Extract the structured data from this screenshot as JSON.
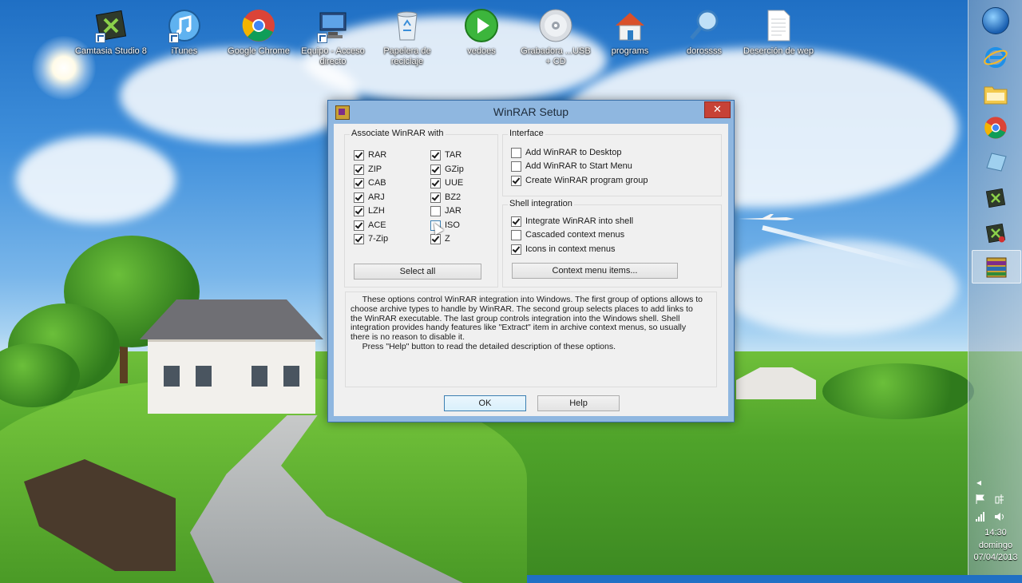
{
  "desktop_icons": [
    {
      "label": "Camtasia Studio 8",
      "icon": "camtasia-icon"
    },
    {
      "label": "iTunes",
      "icon": "itunes-icon"
    },
    {
      "label": "Google Chrome",
      "icon": "chrome-icon"
    },
    {
      "label": "Equipo - Acceso directo",
      "icon": "computer-icon"
    },
    {
      "label": "Papelera de reciclaje",
      "icon": "recycle-bin-icon"
    },
    {
      "label": "vedoes",
      "icon": "play-icon"
    },
    {
      "label": "Grabadora ...USB + CD",
      "icon": "disc-icon"
    },
    {
      "label": "programs",
      "icon": "home-icon"
    },
    {
      "label": "dorossss",
      "icon": "search-icon"
    },
    {
      "label": "Deserción de wep",
      "icon": "document-icon"
    }
  ],
  "dialog": {
    "title": "WinRAR Setup",
    "close_label": "✕",
    "associate": {
      "label": "Associate WinRAR with",
      "col1": [
        {
          "label": "RAR",
          "checked": true
        },
        {
          "label": "ZIP",
          "checked": true
        },
        {
          "label": "CAB",
          "checked": true
        },
        {
          "label": "ARJ",
          "checked": true
        },
        {
          "label": "LZH",
          "checked": true
        },
        {
          "label": "ACE",
          "checked": true
        },
        {
          "label": "7-Zip",
          "checked": true
        }
      ],
      "col2": [
        {
          "label": "TAR",
          "checked": true
        },
        {
          "label": "GZip",
          "checked": true
        },
        {
          "label": "UUE",
          "checked": true
        },
        {
          "label": "BZ2",
          "checked": true
        },
        {
          "label": "JAR",
          "checked": false
        },
        {
          "label": "ISO",
          "checked": false
        },
        {
          "label": "Z",
          "checked": true
        }
      ],
      "select_all_label": "Select all"
    },
    "interface": {
      "label": "Interface",
      "items": [
        {
          "label": "Add WinRAR to Desktop",
          "checked": false
        },
        {
          "label": "Add WinRAR to Start Menu",
          "checked": false
        },
        {
          "label": "Create WinRAR program group",
          "checked": true
        }
      ]
    },
    "shell": {
      "label": "Shell integration",
      "items": [
        {
          "label": "Integrate WinRAR into shell",
          "checked": true
        },
        {
          "label": "Cascaded context menus",
          "checked": false
        },
        {
          "label": "Icons in context menus",
          "checked": true
        }
      ],
      "context_menu_label": "Context menu items..."
    },
    "description": "     These options control WinRAR integration into Windows. The first group of options allows to\nchoose archive types to handle by WinRAR. The second group selects places to add links to\nthe WinRAR executable. The last group controls integration into the Windows shell. Shell\nintegration provides handy features like \"Extract\" item in archive context menus, so usually\nthere is no reason to disable it.\n     Press \"Help\" button to read the detailed description of these options.",
    "ok_label": "OK",
    "help_label": "Help"
  },
  "taskbar": {
    "buttons": [
      "start-orb-icon",
      "internet-explorer-icon",
      "file-explorer-icon",
      "chrome-icon",
      "tablet-icon",
      "camtasia-icon",
      "recorder-icon",
      "winrar-icon"
    ],
    "active": "winrar-icon",
    "time": "14:30",
    "day": "domingo",
    "date": "07/04/2013",
    "show_hidden_label": "◂"
  }
}
